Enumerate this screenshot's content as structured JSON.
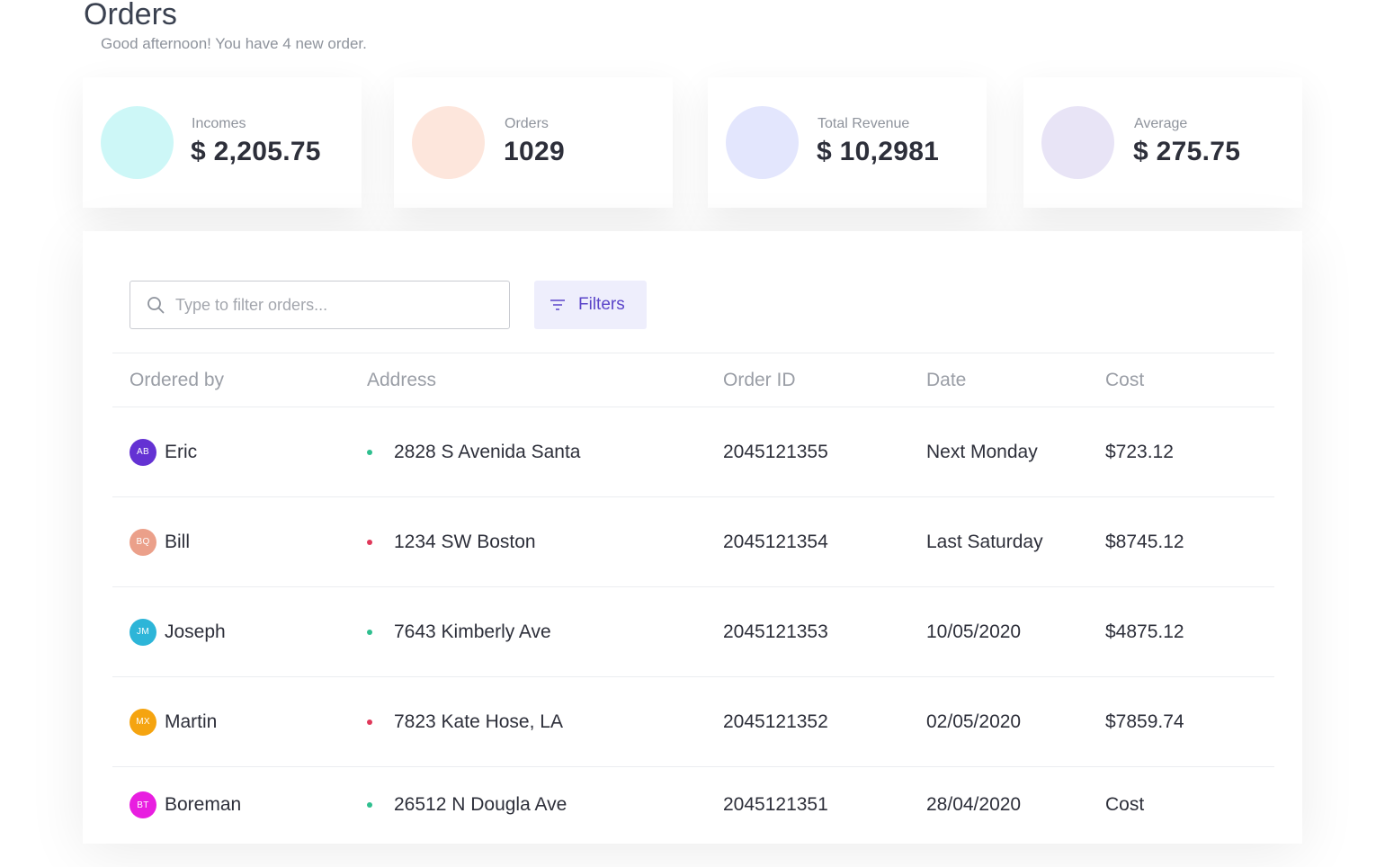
{
  "header": {
    "title": "Orders",
    "subtitle": "Good afternoon! You have 4 new order."
  },
  "stats": [
    {
      "label": "Incomes",
      "value": "$ 2,205.75",
      "color": "#cdf7f7"
    },
    {
      "label": "Orders",
      "value": "1029",
      "color": "#fde6dc"
    },
    {
      "label": "Total Revenue",
      "value": "$ 10,2981",
      "color": "#e3e6fd"
    },
    {
      "label": "Average",
      "value": "$ 275.75",
      "color": "#e8e4f6"
    }
  ],
  "search": {
    "placeholder": "Type to filter orders..."
  },
  "filters": {
    "label": "Filters",
    "color": "#5b45c9"
  },
  "table": {
    "columns": [
      "Ordered by",
      "Address",
      "Order ID",
      "Date",
      "Cost"
    ],
    "rows": [
      {
        "initials": "AB",
        "avatar_color": "#6432d3",
        "name": "Eric",
        "status_color": "#2fbf8f",
        "address": "2828 S Avenida Santa",
        "order_id": "2045121355",
        "date": "Next Monday",
        "cost": "$723.12"
      },
      {
        "initials": "BQ",
        "avatar_color": "#eba08a",
        "name": "Bill",
        "status_color": "#e0385a",
        "address": "1234 SW Boston",
        "order_id": "2045121354",
        "date": "Last Saturday",
        "cost": "$8745.12"
      },
      {
        "initials": "JM",
        "avatar_color": "#2db5d8",
        "name": "Joseph",
        "status_color": "#2fbf8f",
        "address": "7643 Kimberly Ave",
        "order_id": "2045121353",
        "date": "10/05/2020",
        "cost": "$4875.12"
      },
      {
        "initials": "MX",
        "avatar_color": "#f5a410",
        "name": "Martin",
        "status_color": "#e0385a",
        "address": "7823 Kate Hose, LA",
        "order_id": "2045121352",
        "date": "02/05/2020",
        "cost": "$7859.74"
      },
      {
        "initials": "BT",
        "avatar_color": "#e81ee0",
        "name": "Boreman",
        "status_color": "#2fbf8f",
        "address": "26512 N Dougla Ave",
        "order_id": "2045121351",
        "date": "28/04/2020",
        "cost": "Cost"
      }
    ]
  }
}
